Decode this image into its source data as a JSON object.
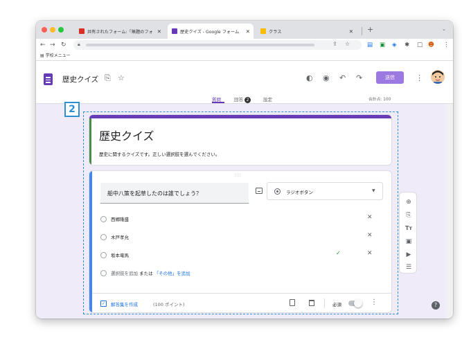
{
  "browser": {
    "tabs": [
      {
        "label": "共有されたフォーム:「無題のフォ",
        "favicon_color": "#d93025"
      },
      {
        "label": "歴史クイズ - Google フォーム",
        "favicon_color": "#673ab7"
      },
      {
        "label": "クラス",
        "favicon_color": "#fbbc04"
      }
    ],
    "bookmark_bar": {
      "folder_label": "学校メニュー"
    }
  },
  "forms": {
    "doc_title": "歴史クイズ",
    "send_label": "送信",
    "tabs": [
      {
        "label": "質問"
      },
      {
        "label": "回答"
      },
      {
        "label": "設定"
      }
    ],
    "responses_count": "2",
    "total_points": "合計点: 100"
  },
  "form": {
    "title": "歴史クイズ",
    "description": "歴史に関するクイズです。正しい選択肢を選んでください。",
    "question": {
      "text": "船中八策を起草したのは誰でしょう？",
      "type_label": "ラジオボタン",
      "options": [
        {
          "label": "西郷隆盛",
          "correct": false
        },
        {
          "label": "木戸孝允",
          "correct": false
        },
        {
          "label": "坂本竜馬",
          "correct": true
        }
      ],
      "add_option_label": "選択肢を追加",
      "or_label": "または",
      "add_other_label": "「その他」を追加",
      "answer_key_label": "解答集を作成",
      "points_label": "(100 ポイント)",
      "required_label": "必須"
    }
  },
  "annotation": {
    "label": "2",
    "color": "#2d8fd3"
  },
  "colors": {
    "accent": "#673ab7",
    "link": "#1a73e8",
    "correct": "#1e8e3e"
  }
}
